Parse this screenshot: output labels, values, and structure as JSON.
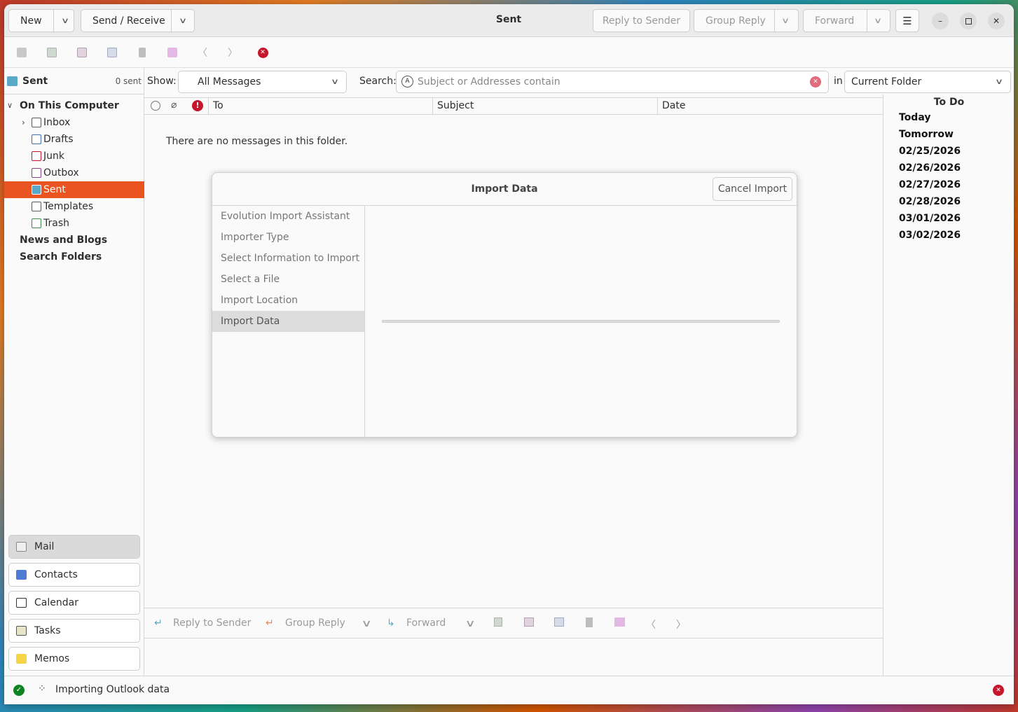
{
  "header": {
    "new_label": "New",
    "send_receive_label": "Send / Receive",
    "title": "Sent",
    "reply_sender_label": "Reply to Sender",
    "group_reply_label": "Group Reply",
    "forward_label": "Forward"
  },
  "sidebar": {
    "folder_title": "Sent",
    "folder_count": "0 sent",
    "account": "On This Computer",
    "folders": [
      "Inbox",
      "Drafts",
      "Junk",
      "Outbox",
      "Sent",
      "Templates",
      "Trash"
    ],
    "groups": [
      "News and Blogs",
      "Search Folders"
    ],
    "switcher": [
      "Mail",
      "Contacts",
      "Calendar",
      "Tasks",
      "Memos"
    ]
  },
  "filter": {
    "show_label": "Show:",
    "show_value": "All Messages",
    "search_label": "Search:",
    "search_placeholder": "Subject or Addresses contain",
    "in_label": "in",
    "scope_value": "Current Folder"
  },
  "columns": [
    "To",
    "Subject",
    "Date"
  ],
  "empty_message": "There are no messages in this folder.",
  "preview_bar": {
    "reply_sender_label": "Reply to Sender",
    "group_reply_label": "Group Reply",
    "forward_label": "Forward"
  },
  "todo": {
    "title": "To Do",
    "dates": [
      "Today",
      "Tomorrow",
      "02/25/2026",
      "02/26/2026",
      "02/27/2026",
      "02/28/2026",
      "03/01/2026",
      "03/02/2026"
    ]
  },
  "dialog": {
    "title": "Import Data",
    "cancel_label": "Cancel Import",
    "steps": [
      "Evolution Import Assistant",
      "Importer Type",
      "Select Information to Import",
      "Select a File",
      "Import Location",
      "Import Data"
    ],
    "current_step": 5,
    "progress": 0
  },
  "status": {
    "text": "Importing Outlook data"
  },
  "colors": {
    "accent": "#e95420",
    "danger": "#c7162b",
    "success": "#0e8420"
  }
}
